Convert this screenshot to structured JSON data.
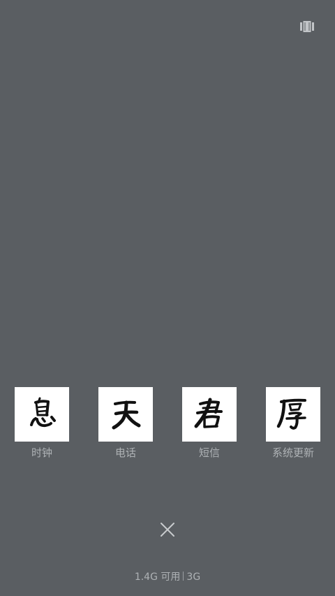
{
  "top_right_icon": "recent-apps-layout-icon",
  "apps": [
    {
      "label": "时钟",
      "icon": "calligraphy-clock-icon"
    },
    {
      "label": "电话",
      "icon": "calligraphy-phone-icon"
    },
    {
      "label": "短信",
      "icon": "calligraphy-sms-icon"
    },
    {
      "label": "系统更新",
      "icon": "calligraphy-update-icon"
    }
  ],
  "close_icon": "close-icon",
  "memory": {
    "available": "1.4G 可用",
    "total": "3G"
  },
  "colors": {
    "background": "#5a5e62",
    "label": "#aeb2b5",
    "tile": "#ffffff",
    "ink": "#111111"
  }
}
